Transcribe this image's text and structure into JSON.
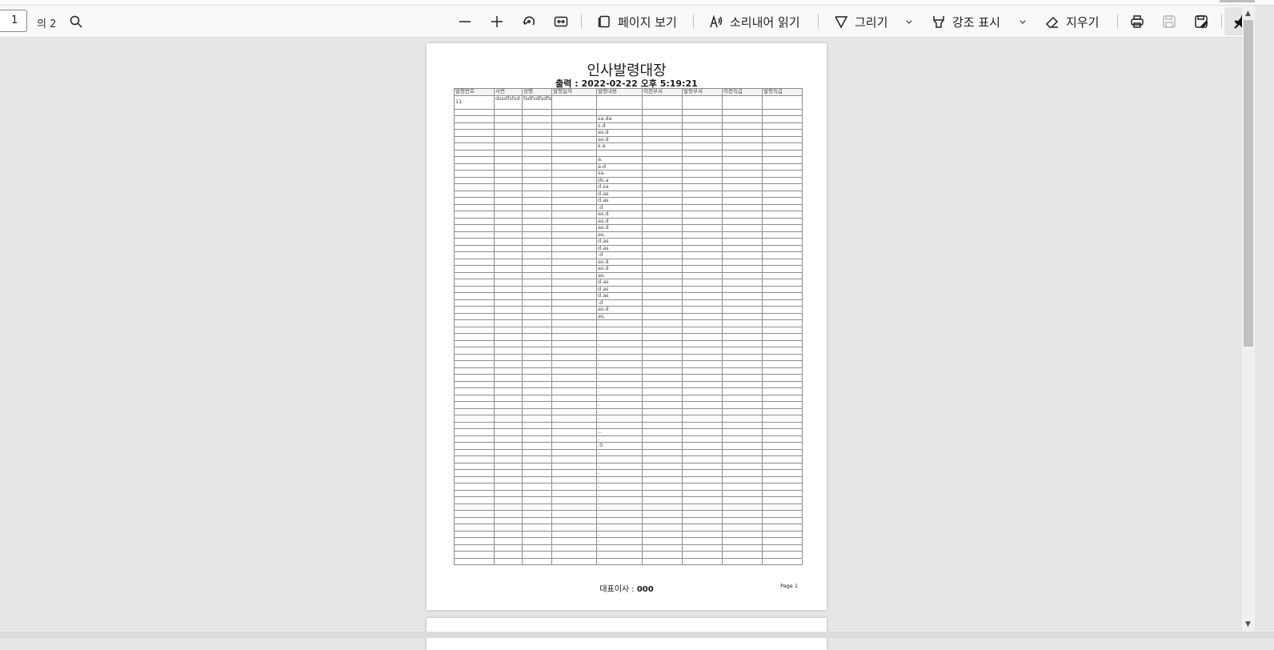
{
  "toolbar": {
    "page_current": "1",
    "page_total": "의 2",
    "view_page_label": "페이지 보기",
    "read_aloud_label": "소리내어 읽기",
    "draw_label": "그리기",
    "highlight_label": "강조 표시",
    "erase_label": "지우기"
  },
  "document": {
    "title": "인사발령대장",
    "printed": "출력 : 2022-02-22 오후 5:19:21",
    "ceo_label": "대표이사 : ",
    "ceo_name": "000",
    "page_label": "Page 1",
    "columns": [
      "발령번호",
      "사번",
      "성명",
      "발령일자",
      "발령내용",
      "이전부서",
      "발령부서",
      "이전직급",
      "발령직급"
    ],
    "first_row": [
      "11",
      "dssdfsfsd",
      "fsdfsdfsdfsd",
      "",
      "",
      "",
      "",
      "",
      ""
    ],
    "content_lines": [
      "",
      "sa.da",
      "s.d",
      "as.d",
      "as.d",
      "s.a",
      "",
      "a.",
      "a.d",
      "sa.",
      "ds.a",
      "d.sa",
      "d.as",
      "d.as",
      ".d",
      "as.d",
      "as.d",
      "as.d",
      "as.",
      "d.as",
      "d.as",
      ".d",
      "as.d",
      "as.d",
      "as.",
      "d.as",
      "d.as",
      "d.as",
      ".d",
      "as.d",
      "as.",
      ".",
      ".",
      ".",
      ".",
      ".",
      ".",
      ".",
      ".",
      ".",
      ".",
      ".",
      ".",
      ".",
      ".",
      ".",
      ".",
      "..",
      ".",
      ".0",
      ".",
      ".",
      ".",
      ".",
      ".",
      ".",
      ".",
      ".",
      ".",
      ".",
      ".",
      ".",
      ".",
      ".",
      ".",
      ".",
      "."
    ]
  }
}
